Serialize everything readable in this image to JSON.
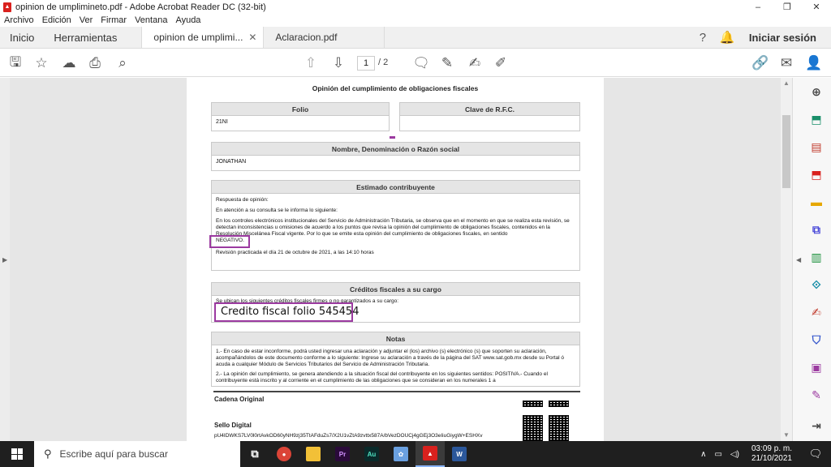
{
  "window": {
    "title": "opinion de umplimineto.pdf - Adobe Acrobat Reader DC (32-bit)",
    "controls": [
      "–",
      "❐",
      "✕"
    ]
  },
  "menu": [
    "Archivo",
    "Edición",
    "Ver",
    "Firmar",
    "Ventana",
    "Ayuda"
  ],
  "tabs": {
    "home": "Inicio",
    "tools": "Herramientas",
    "documents": [
      {
        "label": "opinion de umplimi...",
        "active": true
      },
      {
        "label": "Aclaracion.pdf",
        "active": false
      }
    ],
    "close_glyph": "✕",
    "signin": "Iniciar sesión"
  },
  "toolbar": {
    "page_current": "1",
    "page_total": "/ 2"
  },
  "document": {
    "title": "Opinión del cumplimiento de obligaciones fiscales",
    "folio": {
      "header": "Folio",
      "value": "21NI"
    },
    "rfc": {
      "header": "Clave de R.F.C.",
      "value": ""
    },
    "nombre": {
      "header": "Nombre, Denominación o Razón social",
      "value": "JONATHAN"
    },
    "estimado": {
      "header": "Estimado contribuyente",
      "p1": "Respuesta de opinión:",
      "p2": "En atención a su consulta se le informa lo siguiente:",
      "p3": "En los controles electrónicos institucionales del Servicio de Administración Tributaria, se observa que en el momento en que se realiza esta revisión, se detectan inconsistencias u omisiones de acuerdo a los puntos que revisa la opinión del cumplimiento de obligaciones fiscales, contenidos en la Resolución Miscelánea Fiscal vigente. Por lo que se emite esta opinión del cumplimiento de obligaciones fiscales, en sentido",
      "negativo": "NEGATIVO.",
      "p4": "Revisión practicada el día 21 de octubre de 2021, a las 14:10 horas"
    },
    "creditos": {
      "header": "Créditos fiscales a su cargo",
      "intro": "Se ubican los siguientes créditos fiscales firmes o no garantizados a su cargo:",
      "item": "Credito fiscal folio 545454"
    },
    "notas": {
      "header": "Notas",
      "n1": "1.- En caso de estar inconforme, podrá usted ingresar una aclaración y adjuntar el (los) archivo (s) electrónico (s) que soporten su aclaración, acompañándolos de este documento conforme a lo siguiente: Ingrese su aclaración a través de la página del SAT www.sat.gob.mx desde su Portal ó acuda a cualquier Módulo de Servicios Tributarios del Servicio de Administración Tributaria.",
      "n2": "2.- La opinión del cumplimiento, se genera atendiendo a la situación fiscal del contribuyente en los siguientes sentidos: POSITIVA.- Cuando el contribuyente está inscrito y al corriente en el cumplimiento de las obligaciones que se consideran en los numerales 1 a"
    },
    "cadena_label": "Cadena Original",
    "sello_label": "Sello Digital",
    "sello_value": "pU4IDWKS7LV0l0rtAvkOD60yNH9zj35TtAFduZs7/X2U1vZtA9zvttx587A/bVezDOUCj4gGEj3O3eIiuGiygW+ESHXv"
  },
  "taskbar": {
    "search_placeholder": "Escribe aquí para buscar",
    "time": "03:09 p. m.",
    "date": "21/10/2021"
  },
  "colors": {
    "highlight": "#9b3aa0",
    "acrobat_red": "#d9211e"
  }
}
